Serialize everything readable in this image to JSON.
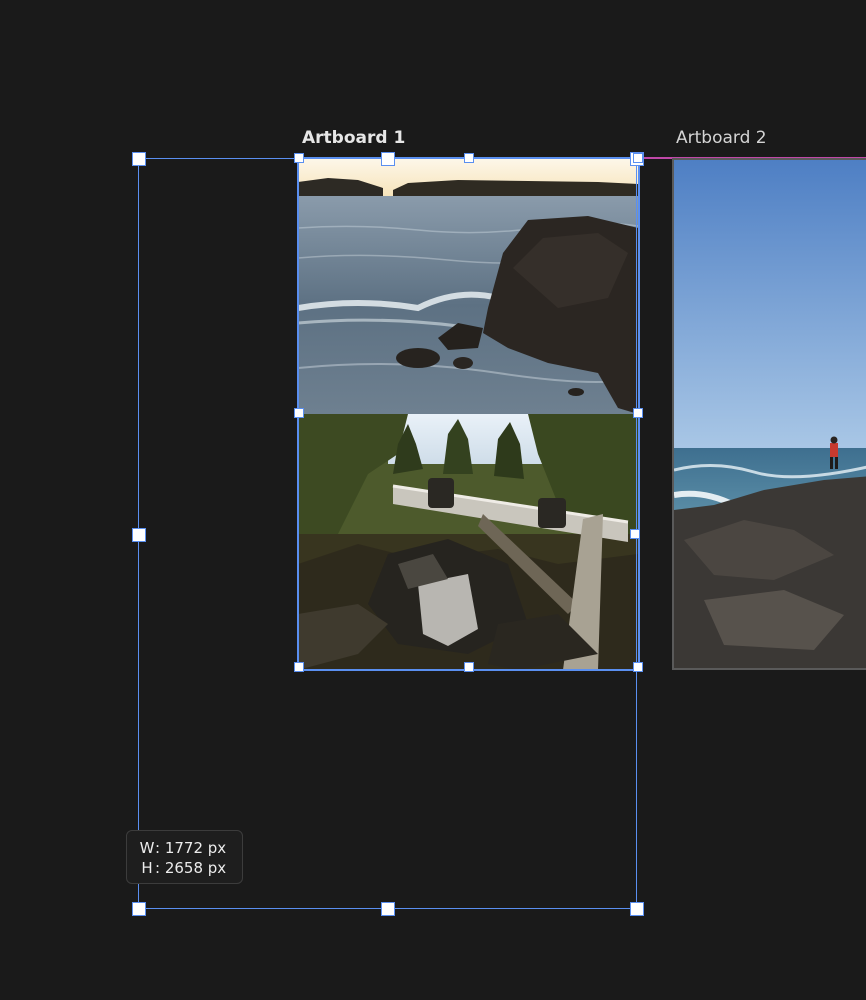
{
  "artboards": [
    {
      "label": "Artboard 1",
      "selected": true
    },
    {
      "label": "Artboard 2",
      "selected": false
    }
  ],
  "size_readout": {
    "w_key": "W",
    "sep": ":",
    "w_value": "1772 px",
    "h_key": "H",
    "h_value": "2658 px"
  },
  "colors": {
    "canvas": "#1a1a1a",
    "selection": "#5a8ff0",
    "artboard_guide": "#c048a8"
  },
  "images": [
    {
      "name": "coast-rocks-sunset-photo"
    },
    {
      "name": "forest-plane-wreck-photo"
    },
    {
      "name": "hiker-on-rocky-shore-photo"
    }
  ]
}
